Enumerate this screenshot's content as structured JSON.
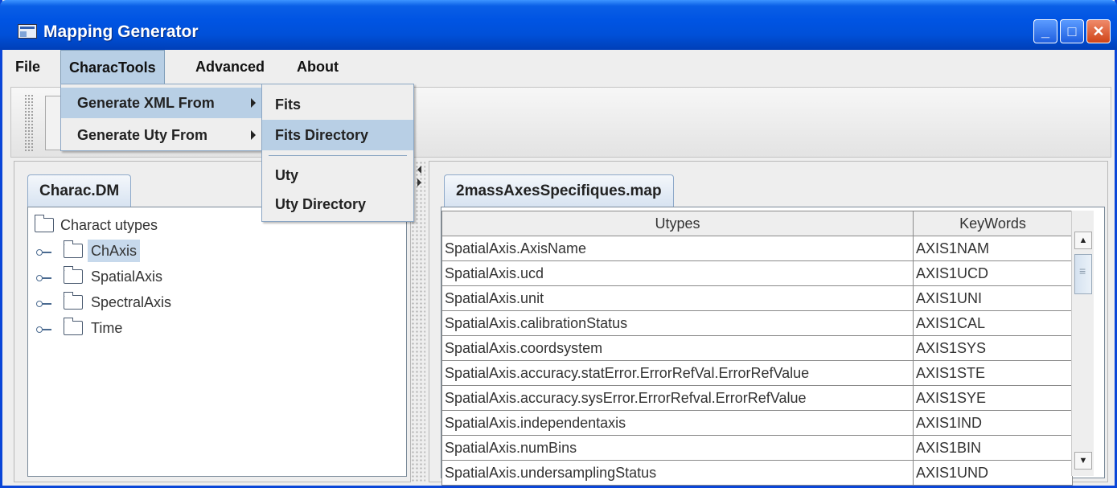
{
  "window": {
    "title": "Mapping Generator",
    "min": "_",
    "max": "□",
    "close": "✕"
  },
  "menubar": {
    "file": "File",
    "characTools": "CharacTools",
    "advanced": "Advanced",
    "about": "About"
  },
  "charac_menu": {
    "xml_from": "Generate XML From",
    "uty_from": "Generate Uty From"
  },
  "submenu": {
    "fits": "Fits",
    "fits_dir": "Fits Directory",
    "uty": "Uty",
    "uty_dir": "Uty Directory"
  },
  "left_panel": {
    "tab": "Charac.DM",
    "tree": {
      "root": "Charact utypes",
      "nodes": [
        "ChAxis",
        "SpatialAxis",
        "SpectralAxis",
        "Time"
      ],
      "selected": "ChAxis"
    }
  },
  "right_panel": {
    "tab": "2massAxesSpecifiques.map",
    "columns": [
      "Utypes",
      "KeyWords"
    ],
    "rows": [
      [
        "SpatialAxis.AxisName",
        "AXIS1NAM"
      ],
      [
        "SpatialAxis.ucd",
        "AXIS1UCD"
      ],
      [
        "SpatialAxis.unit",
        "AXIS1UNI"
      ],
      [
        "SpatialAxis.calibrationStatus",
        "AXIS1CAL"
      ],
      [
        "SpatialAxis.coordsystem",
        "AXIS1SYS"
      ],
      [
        "SpatialAxis.accuracy.statError.ErrorRefVal.ErrorRefValue",
        "AXIS1STE"
      ],
      [
        "SpatialAxis.accuracy.sysError.ErrorRefval.ErrorRefValue",
        "AXIS1SYE"
      ],
      [
        "SpatialAxis.independentaxis",
        "AXIS1IND"
      ],
      [
        "SpatialAxis.numBins",
        "AXIS1BIN"
      ],
      [
        "SpatialAxis.undersamplingStatus",
        "AXIS1UND"
      ]
    ]
  }
}
